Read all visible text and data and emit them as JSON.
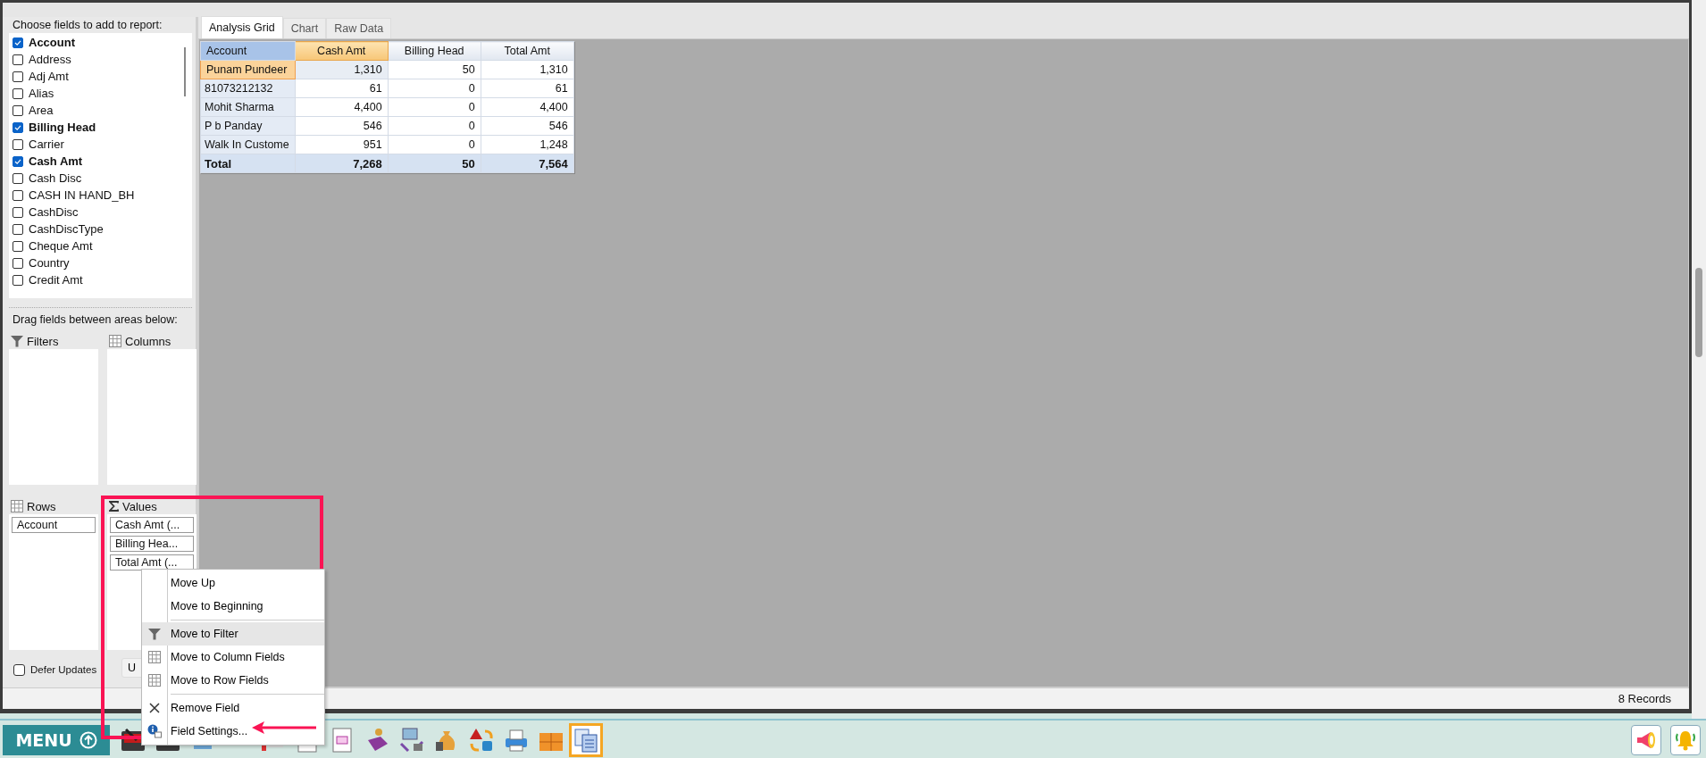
{
  "field_list": {
    "title": "Choose fields to add to report:",
    "fields": [
      {
        "label": "Account",
        "checked": true
      },
      {
        "label": "Address",
        "checked": false
      },
      {
        "label": "Adj Amt",
        "checked": false
      },
      {
        "label": "Alias",
        "checked": false
      },
      {
        "label": "Area",
        "checked": false
      },
      {
        "label": "Billing Head",
        "checked": true
      },
      {
        "label": "Carrier",
        "checked": false
      },
      {
        "label": "Cash Amt",
        "checked": true
      },
      {
        "label": "Cash Disc",
        "checked": false
      },
      {
        "label": "CASH IN HAND_BH",
        "checked": false
      },
      {
        "label": "CashDisc",
        "checked": false
      },
      {
        "label": "CashDiscType",
        "checked": false
      },
      {
        "label": "Cheque Amt",
        "checked": false
      },
      {
        "label": "Country",
        "checked": false
      },
      {
        "label": "Credit Amt",
        "checked": false
      }
    ]
  },
  "areas": {
    "title": "Drag fields between areas below:",
    "filters": {
      "label": "Filters"
    },
    "columns": {
      "label": "Columns"
    },
    "rows": {
      "label": "Rows",
      "items": [
        "Account"
      ]
    },
    "values": {
      "label": "Values",
      "items": [
        "Cash Amt (...",
        "Billing Hea...",
        "Total Amt (..."
      ]
    }
  },
  "defer_updates": {
    "label": "Defer Updates",
    "checked": false
  },
  "update_button": "U",
  "tabs": [
    {
      "label": "Analysis Grid",
      "selected": true
    },
    {
      "label": "Chart",
      "selected": false
    },
    {
      "label": "Raw Data",
      "selected": false
    }
  ],
  "grid": {
    "columns": [
      {
        "label": "Account",
        "selected": false
      },
      {
        "label": "Cash Amt",
        "selected": true
      },
      {
        "label": "Billing Head",
        "selected": false
      },
      {
        "label": "Total Amt",
        "selected": false
      }
    ],
    "rows": [
      {
        "account": "Punam Pundeer",
        "values": [
          "1,310",
          "50",
          "1,310"
        ],
        "selected": true
      },
      {
        "account": "81073212132",
        "values": [
          "61",
          "0",
          "61"
        ],
        "selected": false
      },
      {
        "account": "Mohit Sharma",
        "values": [
          "4,400",
          "0",
          "4,400"
        ],
        "selected": false
      },
      {
        "account": "P b Panday",
        "values": [
          "546",
          "0",
          "546"
        ],
        "selected": false
      },
      {
        "account": "Walk In Custome",
        "values": [
          "951",
          "0",
          "1,248"
        ],
        "selected": false
      }
    ],
    "total": {
      "label": "Total",
      "values": [
        "7,268",
        "50",
        "7,564"
      ]
    }
  },
  "status_bar": "8 Records",
  "context_menu": {
    "groups": [
      [
        {
          "label": "Move Up",
          "kind": "plain",
          "selected": false
        },
        {
          "label": "Move to Beginning",
          "kind": "plain",
          "selected": false
        }
      ],
      [
        {
          "label": "Move to Filter",
          "kind": "filter",
          "selected": true
        },
        {
          "label": "Move to Column Fields",
          "kind": "grid",
          "selected": false
        },
        {
          "label": "Move to Row Fields",
          "kind": "grid",
          "selected": false
        }
      ],
      [
        {
          "label": "Remove Field",
          "kind": "remove",
          "selected": false
        },
        {
          "label": "Field Settings...",
          "kind": "settings",
          "selected": false
        }
      ]
    ]
  },
  "taskbar": {
    "menu_button": "MENU"
  }
}
